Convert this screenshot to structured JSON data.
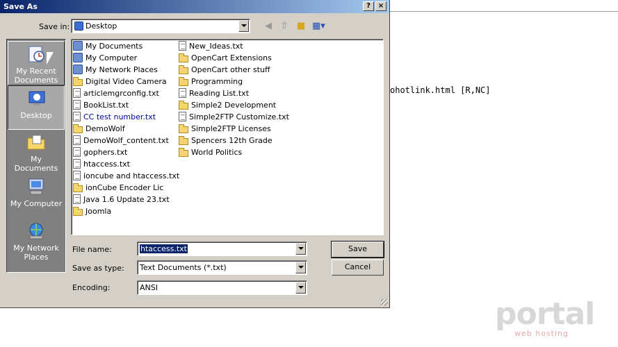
{
  "editor": {
    "visible_text": "ohotlink.html [R,NC]"
  },
  "dialog": {
    "title": "Save As",
    "help_button": "?",
    "close_button": "×",
    "save_in_label": "Save in:",
    "save_in_value": "Desktop"
  },
  "places": [
    {
      "label": "My Recent Documents",
      "icon": "clock-icon"
    },
    {
      "label": "Desktop",
      "icon": "desktop-icon"
    },
    {
      "label": "My Documents",
      "icon": "folder-icon"
    },
    {
      "label": "My Computer",
      "icon": "computer-icon"
    },
    {
      "label": "My Network Places",
      "icon": "network-icon"
    }
  ],
  "files": {
    "col1": [
      {
        "name": "My Documents",
        "type": "special"
      },
      {
        "name": "My Computer",
        "type": "special"
      },
      {
        "name": "My Network Places",
        "type": "special"
      },
      {
        "name": "Digital Video Camera",
        "type": "folder"
      },
      {
        "name": "articlemgrconfig.txt",
        "type": "doc"
      },
      {
        "name": "BookList.txt",
        "type": "doc"
      },
      {
        "name": "CC test number.txt",
        "type": "doc"
      },
      {
        "name": "DemoWolf",
        "type": "folder"
      },
      {
        "name": "DemoWolf_content.txt",
        "type": "doc"
      },
      {
        "name": "gophers.txt",
        "type": "doc"
      },
      {
        "name": "htaccess.txt",
        "type": "doc"
      },
      {
        "name": "ioncube and htaccess.txt",
        "type": "doc"
      },
      {
        "name": "ionCube Encoder Lic",
        "type": "folder"
      },
      {
        "name": "Java 1.6 Update 23.txt",
        "type": "doc"
      },
      {
        "name": "Joomla",
        "type": "folder"
      }
    ],
    "col2": [
      {
        "name": "New_Ideas.txt",
        "type": "doc"
      },
      {
        "name": "OpenCart Extensions",
        "type": "folder"
      },
      {
        "name": "OpenCart other stuff",
        "type": "folder"
      },
      {
        "name": "Programming",
        "type": "folder"
      },
      {
        "name": "Reading List.txt",
        "type": "doc"
      },
      {
        "name": "Simple2 Development",
        "type": "folder"
      },
      {
        "name": "Simple2FTP Customize.txt",
        "type": "doc"
      },
      {
        "name": "Simple2FTP Licenses",
        "type": "folder"
      },
      {
        "name": "Spencers 12th Grade",
        "type": "folder"
      },
      {
        "name": "World Politics",
        "type": "folder"
      }
    ]
  },
  "form": {
    "file_name_label": "File name:",
    "file_name_value": "htaccess.txt",
    "save_as_type_label": "Save as type:",
    "save_as_type_value": "Text Documents (*.txt)",
    "encoding_label": "Encoding:",
    "encoding_value": "ANSI",
    "save_button": "Save",
    "cancel_button": "Cancel"
  },
  "watermark": {
    "brand": "portal",
    "sub": "web hosting"
  }
}
